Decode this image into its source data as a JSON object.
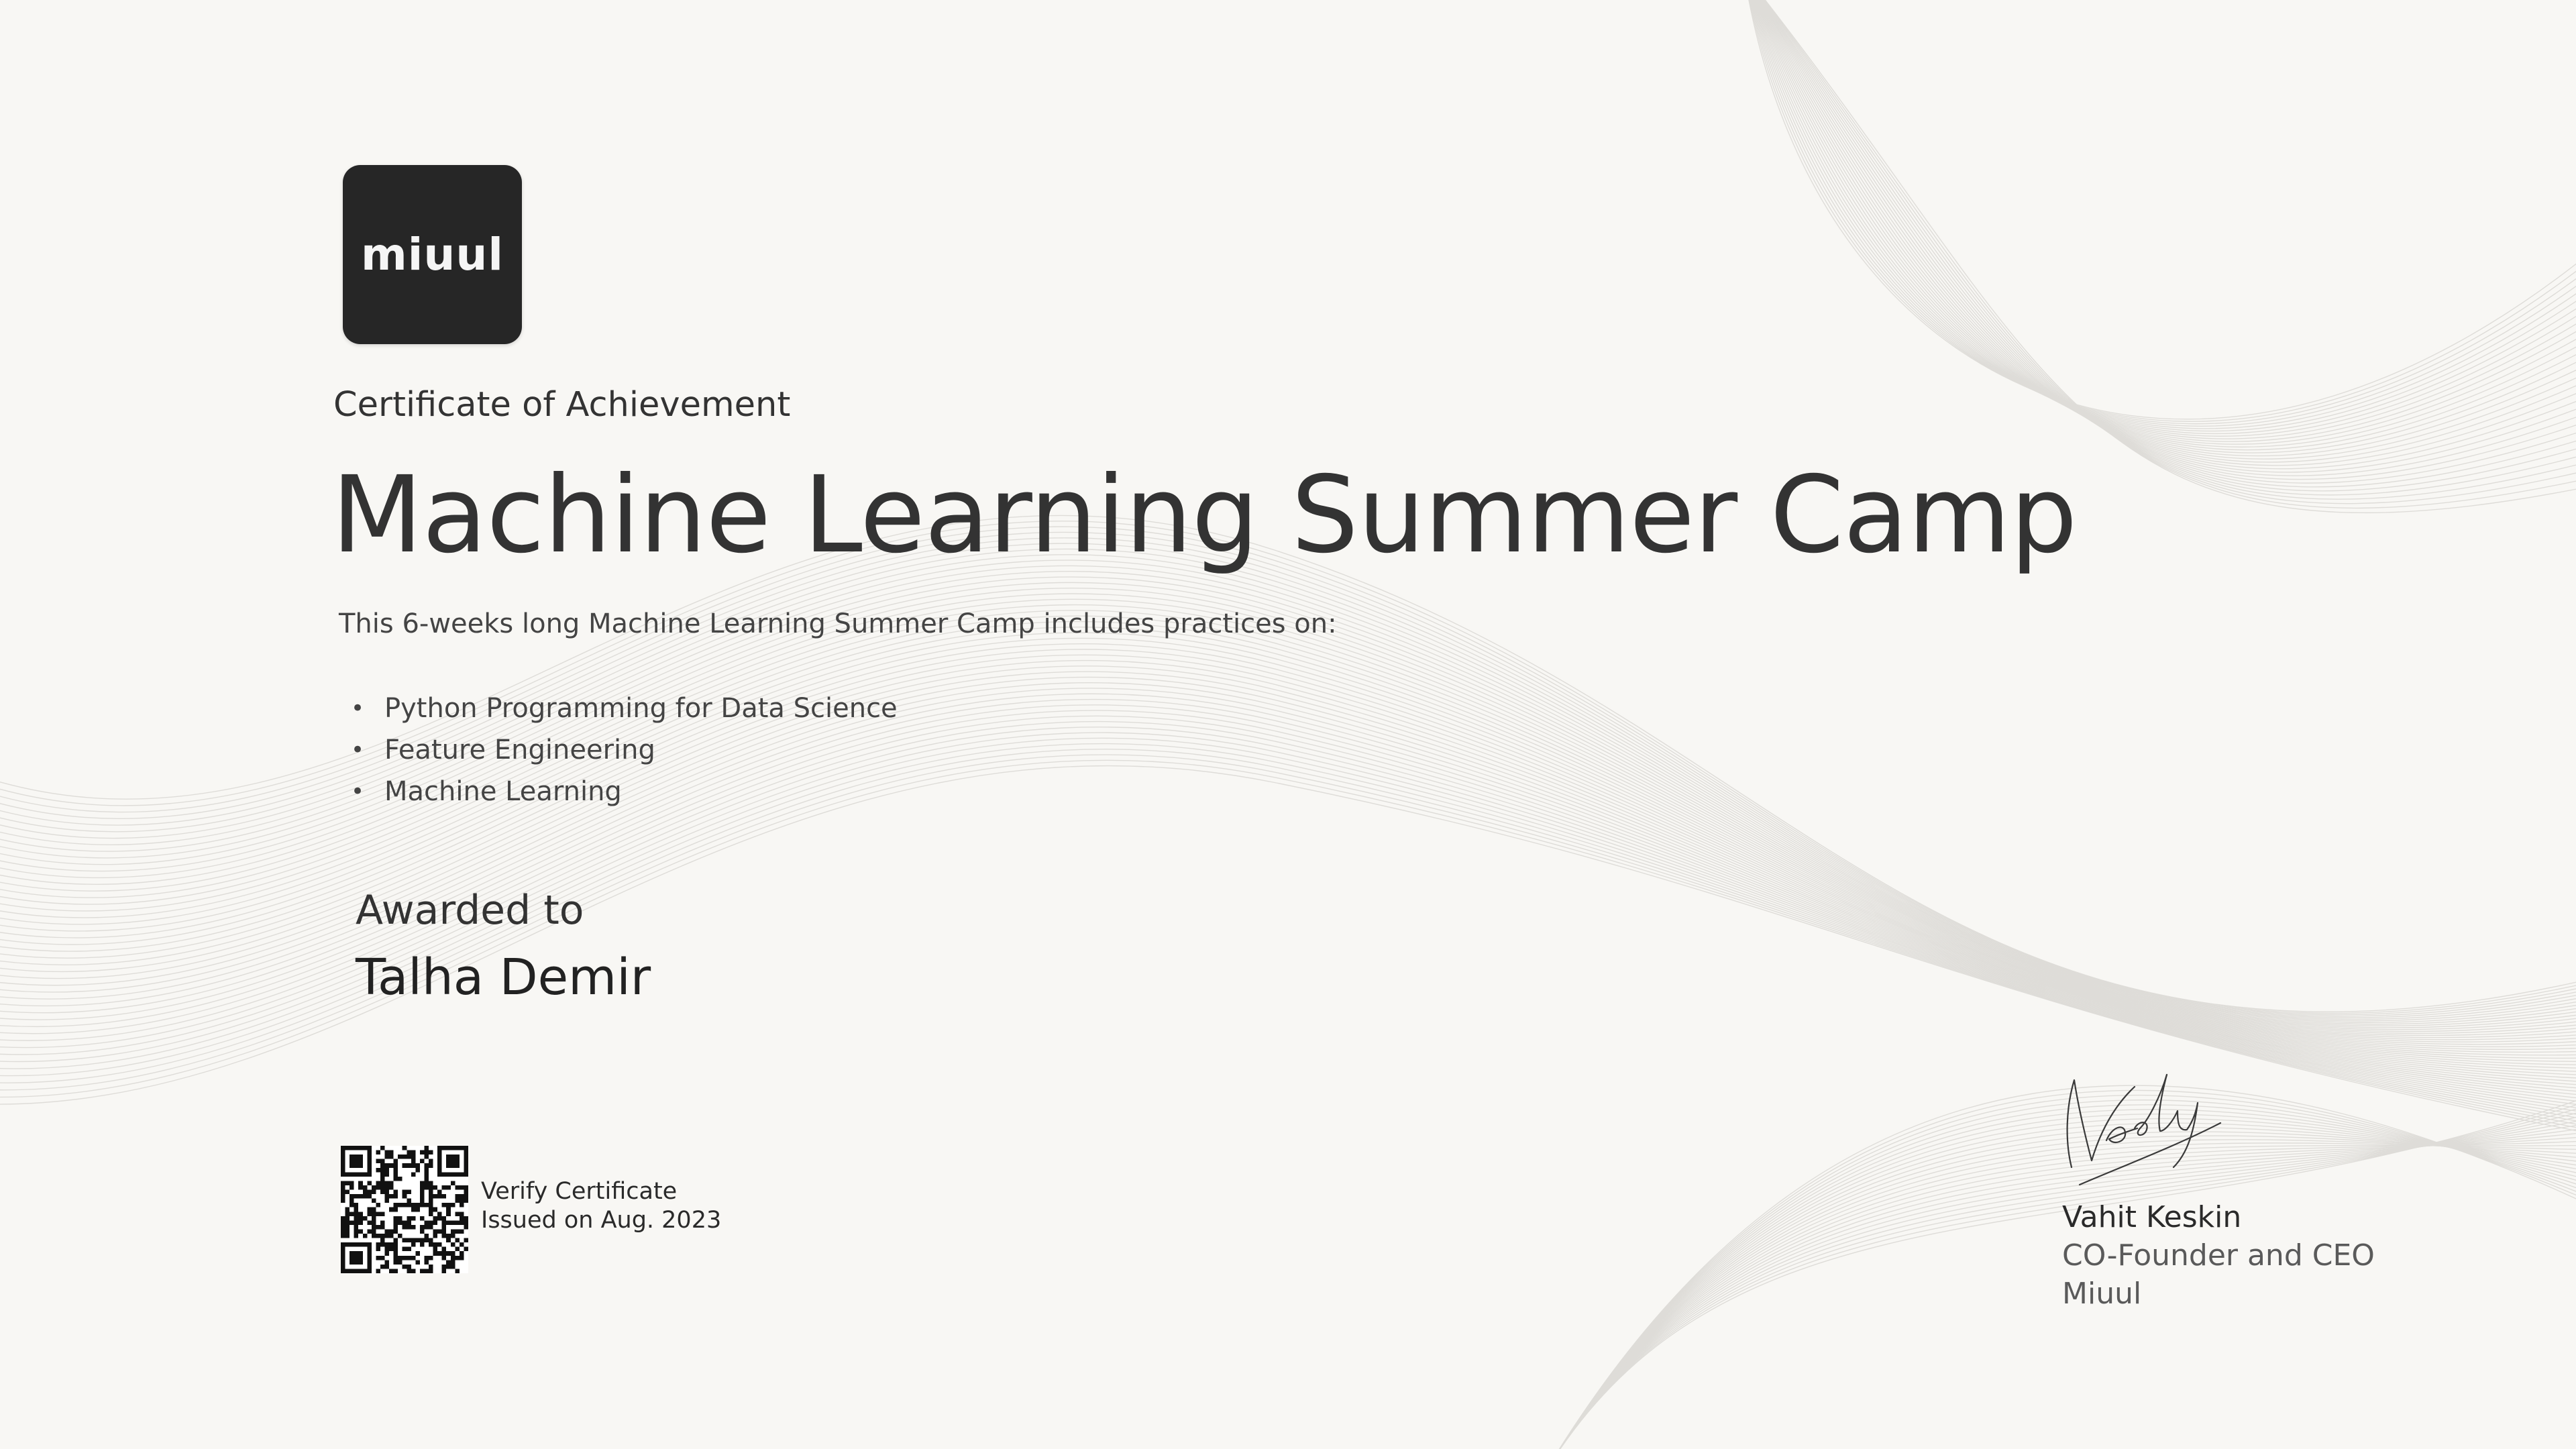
{
  "brand": {
    "logo_text": "miuul"
  },
  "certificate": {
    "kicker": "Certificate of Achievement",
    "title": "Machine Learning Summer Camp",
    "description": "This 6-weeks long Machine Learning Summer Camp includes practices on:",
    "topics": [
      "Python Programming for Data Science",
      "Feature Engineering",
      "Machine Learning"
    ],
    "bullet": "•",
    "awarded_label": "Awarded to",
    "recipient": "Talha Demir"
  },
  "verification": {
    "label": "Verify Certificate",
    "issued": "Issued on Aug. 2023"
  },
  "signatory": {
    "name": "Vahit Keskin",
    "role": "CO-Founder and CEO",
    "organization": "Miuul"
  },
  "colors": {
    "background": "#f8f7f4",
    "logo_tile": "#262626",
    "text": "#333333"
  }
}
